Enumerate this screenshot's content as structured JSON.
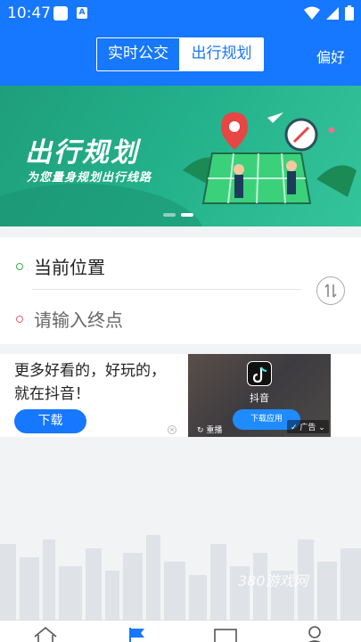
{
  "status_bar": {
    "time": "10:47"
  },
  "header": {
    "tabs": [
      {
        "label": "实时公交",
        "active": false
      },
      {
        "label": "出行规划",
        "active": true
      }
    ],
    "preference_label": "偏好"
  },
  "banner": {
    "title": "出行规划",
    "subtitle": "为您量身规划出行线路",
    "page_indicator": {
      "count": 2,
      "active_index": 1
    }
  },
  "route": {
    "current_location": "当前位置",
    "destination_placeholder": "请输入终点"
  },
  "ad": {
    "text_line1": "更多好看的，好玩的，",
    "text_line2": "就在抖音！",
    "download_label": "下载",
    "app_name": "抖音",
    "app_download_label": "下载应用",
    "replay_label": "重播",
    "ad_tag": "广告"
  },
  "watermark": "380游戏网",
  "colors": {
    "primary": "#1677ff",
    "banner_green": "#22b08a",
    "current_dot": "#3cb043",
    "destination_dot": "#e06070"
  },
  "bottom_nav": [
    "home-icon",
    "flag-icon",
    "card-icon",
    "user-icon"
  ]
}
